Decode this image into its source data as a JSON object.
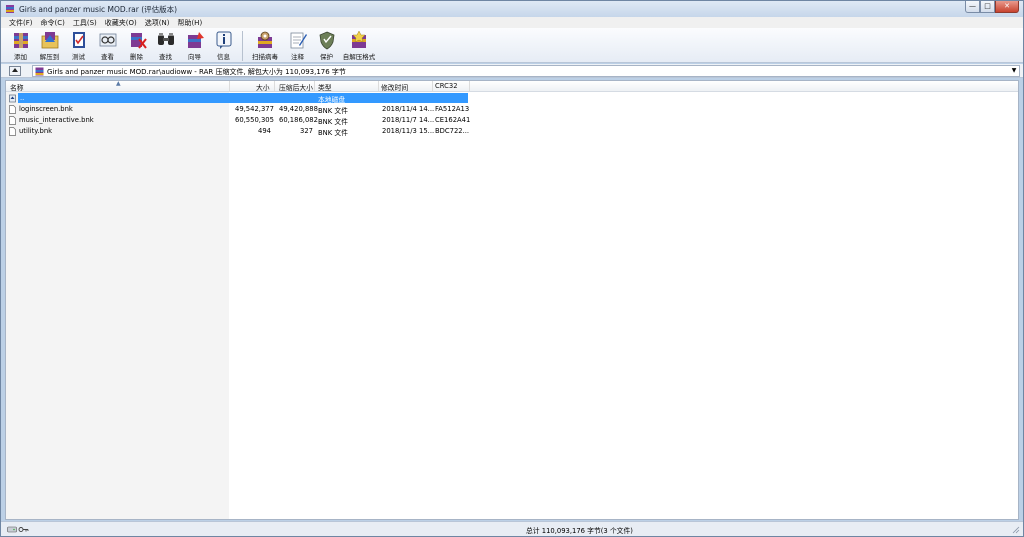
{
  "window": {
    "title": "Girls and panzer music MOD.rar (评估版本)",
    "controls": {
      "minimize": "—",
      "maximize": "□",
      "close": "✕"
    }
  },
  "menu": [
    "文件(F)",
    "命令(C)",
    "工具(S)",
    "收藏夹(O)",
    "选项(N)",
    "帮助(H)"
  ],
  "toolbar": [
    {
      "label": "添加",
      "icon": "add-archive-icon"
    },
    {
      "label": "解压到",
      "icon": "extract-to-icon"
    },
    {
      "label": "测试",
      "icon": "test-icon"
    },
    {
      "label": "查看",
      "icon": "view-icon"
    },
    {
      "label": "删除",
      "icon": "delete-icon"
    },
    {
      "label": "查找",
      "icon": "find-icon"
    },
    {
      "label": "向导",
      "icon": "wizard-icon"
    },
    {
      "label": "信息",
      "icon": "info-icon"
    },
    {
      "label": "扫描病毒",
      "icon": "virus-scan-icon"
    },
    {
      "label": "注释",
      "icon": "comment-icon"
    },
    {
      "label": "保护",
      "icon": "protect-icon"
    },
    {
      "label": "自解压格式",
      "icon": "sfx-icon"
    }
  ],
  "address": {
    "path": "Girls and panzer music MOD.rar\\audioww - RAR 压缩文件, 解包大小为 110,093,176 字节"
  },
  "columns": {
    "name": "名称",
    "size": "大小",
    "packed": "压缩后大小",
    "type": "类型",
    "modified": "修改时间",
    "crc": "CRC32"
  },
  "files": [
    {
      "name": "..",
      "size": "",
      "packed": "",
      "type": "本地磁盘",
      "modified": "",
      "crc": "",
      "selected": true
    },
    {
      "name": "loginscreen.bnk",
      "size": "49,542,377",
      "packed": "49,420,888",
      "type": "BNK 文件",
      "modified": "2018/11/4 14...",
      "crc": "FA512A13"
    },
    {
      "name": "music_interactive.bnk",
      "size": "60,550,305",
      "packed": "60,186,082",
      "type": "BNK 文件",
      "modified": "2018/11/7 14...",
      "crc": "CE162A41"
    },
    {
      "name": "utility.bnk",
      "size": "494",
      "packed": "327",
      "type": "BNK 文件",
      "modified": "2018/11/3 15...",
      "crc": "BDC722..."
    }
  ],
  "status": {
    "summary": "总计 110,093,176 字节(3 个文件)"
  },
  "colors": {
    "selection": "#3399ff",
    "window_frame": "#bcd0e6"
  }
}
